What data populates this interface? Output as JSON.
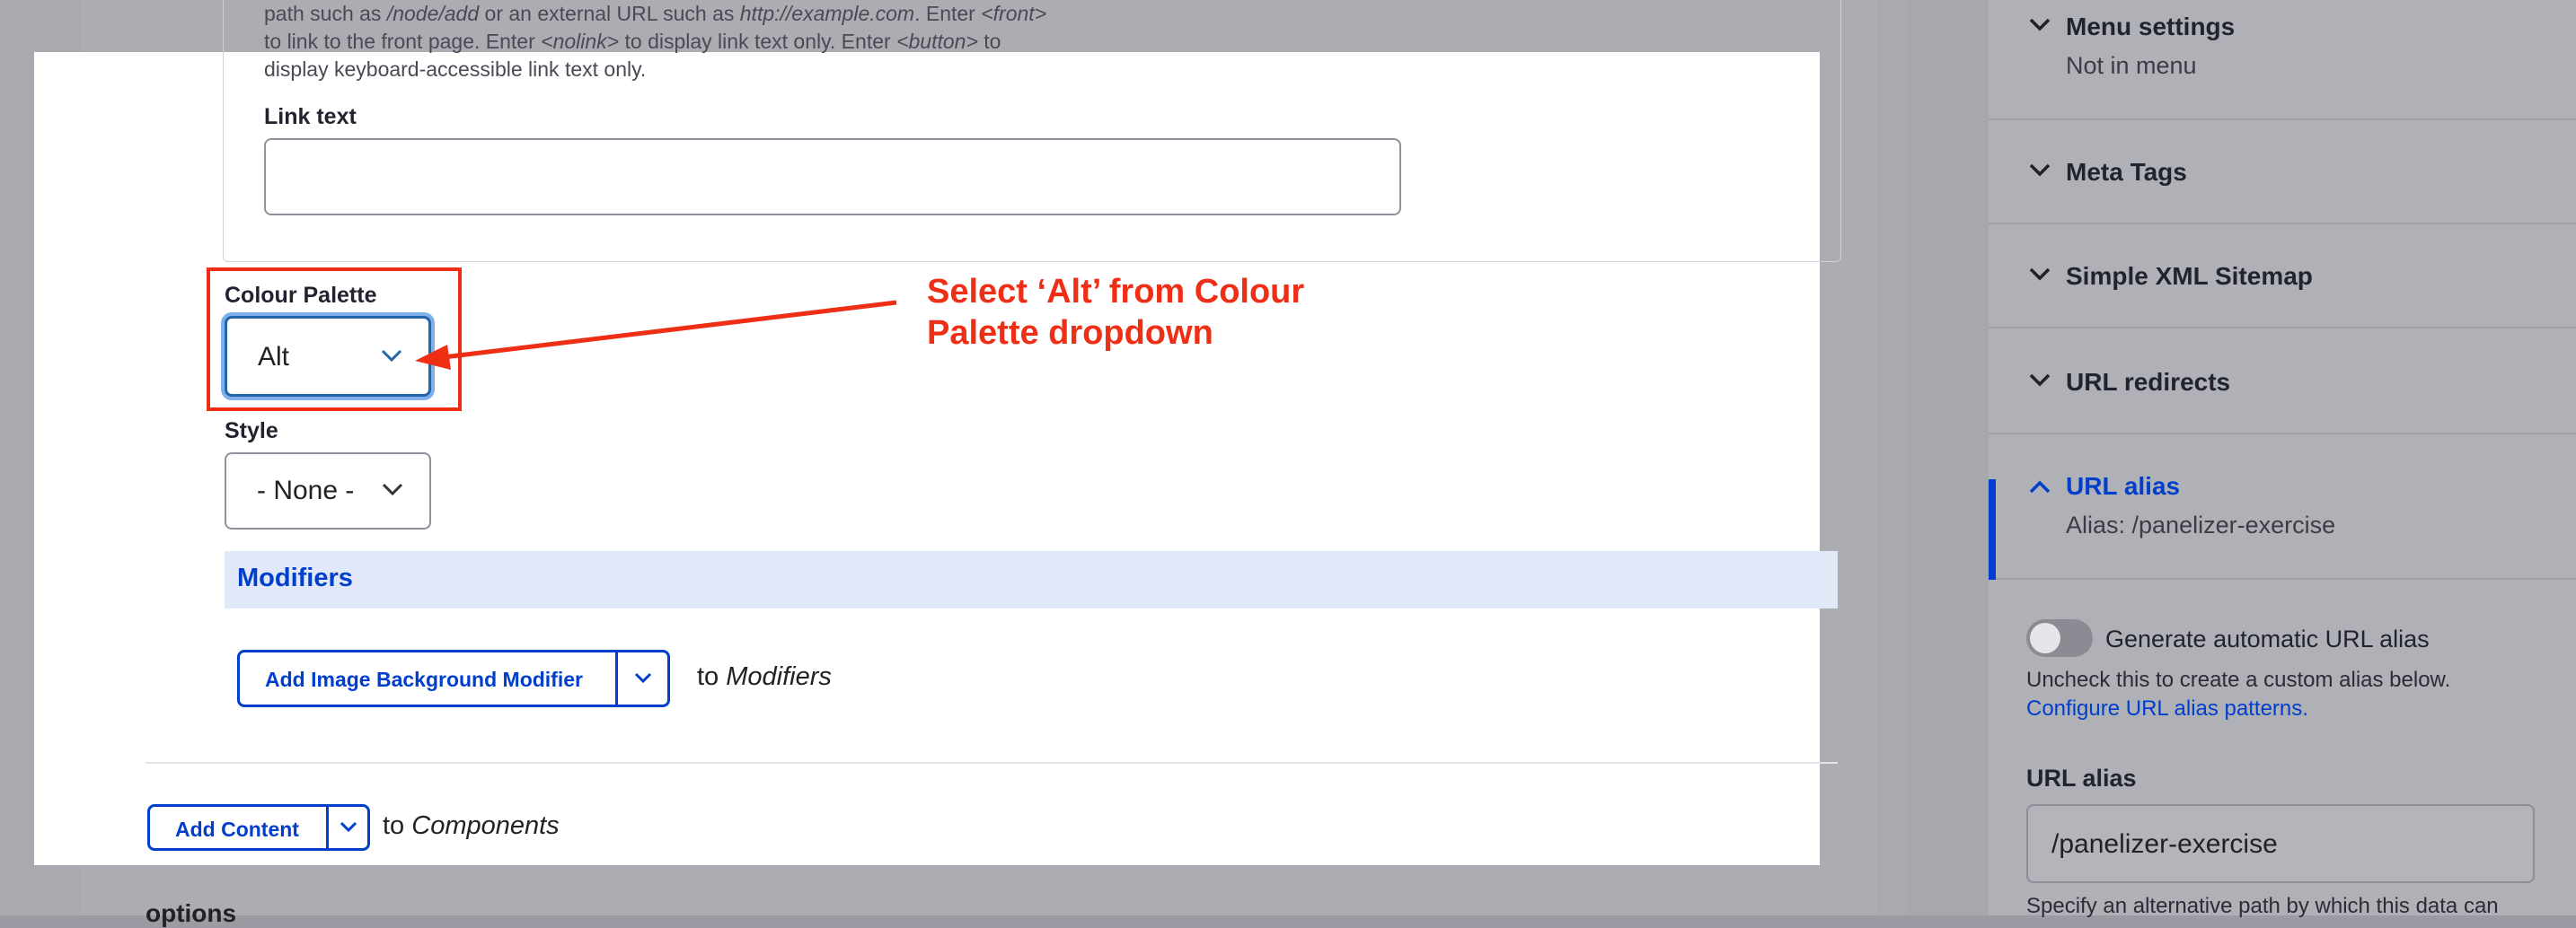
{
  "form": {
    "help_text_part1": "path such as ",
    "help_text_path1": "/node/add",
    "help_text_part2": " or an external URL such as ",
    "help_text_url": "http://example.com",
    "help_text_part3": ". Enter ",
    "help_text_front": "<front>",
    "help_text_line2a": "to link to the front page. Enter ",
    "help_text_nolink": "<nolink>",
    "help_text_line2b": " to display link text only. Enter ",
    "help_text_button": "<button>",
    "help_text_line2c": " to",
    "help_text_line3": "display keyboard-accessible link text only.",
    "link_text_label": "Link text",
    "link_text_value": "",
    "colour_palette_label": "Colour Palette",
    "colour_palette_value": "Alt",
    "style_label": "Style",
    "style_value": "- None -",
    "modifiers_title": "Modifiers",
    "add_image_bg_modifier_label": "Add Image Background Modifier",
    "to_word": "to",
    "modifiers_target": "Modifiers",
    "add_content_label": "Add Content",
    "components_target": "Components",
    "options_label": "options"
  },
  "annotation": {
    "text_line1": "Select ‘Alt’ from Colour",
    "text_line2": "Palette dropdown",
    "color": "#ef2e16"
  },
  "sidebar": {
    "sections": [
      {
        "title": "Menu settings",
        "subtitle": "Not in menu",
        "expanded": false
      },
      {
        "title": "Meta Tags",
        "subtitle": "",
        "expanded": false
      },
      {
        "title": "Simple XML Sitemap",
        "subtitle": "",
        "expanded": false
      },
      {
        "title": "URL redirects",
        "subtitle": "",
        "expanded": false
      },
      {
        "title": "URL alias",
        "subtitle": "Alias: /panelizer-exercise",
        "expanded": true
      }
    ],
    "generate_alias_label": "Generate automatic URL alias",
    "generate_alias_enabled": false,
    "alias_help": "Uncheck this to create a custom alias below.",
    "alias_patterns_link": "Configure URL alias patterns.",
    "alias_field_label": "URL alias",
    "alias_field_value": "/panelizer-exercise",
    "alias_field_desc": "Specify an alternative path by which this data can"
  },
  "colors": {
    "accent": "#003ecc",
    "annotation": "#ef2e16"
  }
}
